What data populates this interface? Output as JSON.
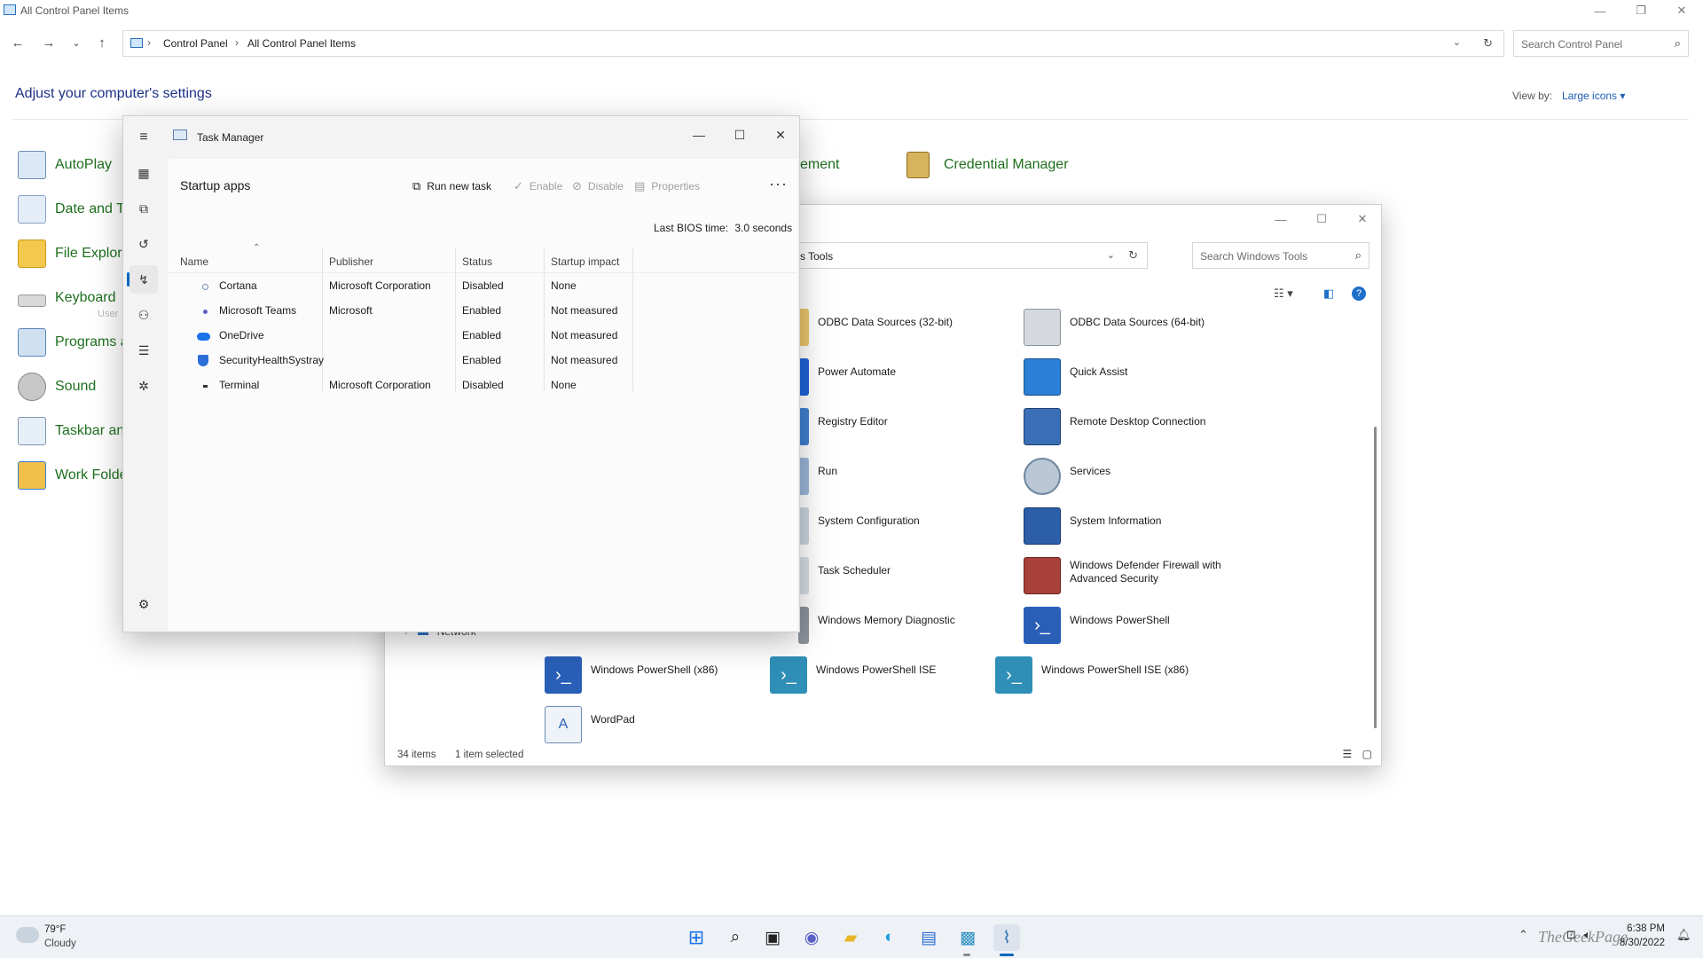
{
  "control_panel": {
    "window_title": "All Control Panel Items",
    "breadcrumb": [
      "Control Panel",
      "All Control Panel Items"
    ],
    "search_placeholder": "Search Control Panel",
    "heading": "Adjust your computer's settings",
    "view_by_label": "View by:",
    "view_by_value": "Large icons ▾",
    "items_left": [
      "AutoPlay",
      "Date and Ti",
      "File Explore",
      "Keyboard",
      "Programs a",
      "Sound",
      "Taskbar anc",
      "Work Folde"
    ],
    "items_right": [
      "ement",
      "Credential Manager"
    ],
    "tooltip_fragment": "User"
  },
  "windows_tools": {
    "address": "s Tools",
    "search_placeholder": "Search Windows Tools",
    "nav_network": "Network",
    "status_items": "34 items",
    "status_selected": "1 item selected",
    "items": [
      {
        "label": "ODBC Data Sources (32-bit)",
        "icon": "odbc-icon"
      },
      {
        "label": "ODBC Data Sources (64-bit)",
        "icon": "odbc-icon"
      },
      {
        "label": "Power Automate",
        "icon": "power-automate-icon"
      },
      {
        "label": "Quick Assist",
        "icon": "quick-assist-icon"
      },
      {
        "label": "Registry Editor",
        "icon": "registry-icon"
      },
      {
        "label": "Remote Desktop Connection",
        "icon": "remote-desktop-icon"
      },
      {
        "label": "Run",
        "icon": "run-icon"
      },
      {
        "label": "Services",
        "icon": "services-icon"
      },
      {
        "label": "System Configuration",
        "icon": "msconfig-icon"
      },
      {
        "label": "System Information",
        "icon": "system-info-icon"
      },
      {
        "label": "Task Scheduler",
        "icon": "task-scheduler-icon"
      },
      {
        "label": "Windows Defender Firewall with Advanced Security",
        "icon": "firewall-icon"
      },
      {
        "label": "Windows Memory Diagnostic",
        "icon": "memory-diagnostic-icon"
      },
      {
        "label": "Windows PowerShell",
        "icon": "powershell-icon"
      },
      {
        "label": "Windows PowerShell (x86)",
        "icon": "powershell-icon"
      },
      {
        "label": "Windows PowerShell ISE",
        "icon": "powershell-ise-icon"
      },
      {
        "label": "Windows PowerShell ISE (x86)",
        "icon": "powershell-ise-icon"
      },
      {
        "label": "WordPad",
        "icon": "wordpad-icon"
      }
    ]
  },
  "task_manager": {
    "title": "Task Manager",
    "page_title": "Startup apps",
    "commands": {
      "run_new_task": "Run new task",
      "enable": "Enable",
      "disable": "Disable",
      "properties": "Properties"
    },
    "bios_label": "Last BIOS time:",
    "bios_value": "3.0 seconds",
    "columns": [
      "Name",
      "Publisher",
      "Status",
      "Startup impact"
    ],
    "rows": [
      {
        "name": "Cortana",
        "publisher": "Microsoft Corporation",
        "status": "Disabled",
        "impact": "None",
        "icon": "cortana-icon"
      },
      {
        "name": "Microsoft Teams",
        "publisher": "Microsoft",
        "status": "Enabled",
        "impact": "Not measured",
        "icon": "teams-icon"
      },
      {
        "name": "OneDrive",
        "publisher": "",
        "status": "Enabled",
        "impact": "Not measured",
        "icon": "onedrive-icon"
      },
      {
        "name": "SecurityHealthSystray",
        "publisher": "",
        "status": "Enabled",
        "impact": "Not measured",
        "icon": "shield-icon"
      },
      {
        "name": "Terminal",
        "publisher": "Microsoft Corporation",
        "status": "Disabled",
        "impact": "None",
        "icon": "terminal-icon"
      }
    ]
  },
  "taskbar": {
    "weather_temp": "79°F",
    "weather_condition": "Cloudy",
    "time": "6:38 PM",
    "date": "8/30/2022",
    "watermark": "TheGeekPage"
  },
  "colors": {
    "accent": "#0067c0",
    "link_green": "#1f6f1f",
    "heading_blue": "#1e3287"
  }
}
